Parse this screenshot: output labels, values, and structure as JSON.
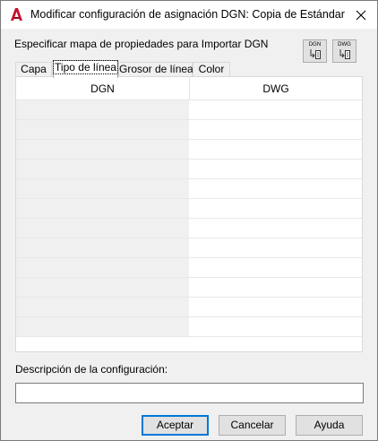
{
  "window": {
    "title": "Modificar configuración de asignación DGN: Copia de Estándar",
    "accent_color": "#0078d7",
    "app_icon": "autocad-logo-icon",
    "close_icon": "close-icon"
  },
  "prompt": "Especificar mapa de propiedades para Importar DGN",
  "icon_buttons": [
    {
      "label": "DGN",
      "icon": "import-from-dgn-icon"
    },
    {
      "label": "DWG",
      "icon": "import-from-dwg-icon"
    }
  ],
  "tabs": [
    {
      "label": "Capa",
      "active": false
    },
    {
      "label": "Tipo de línea",
      "active": true
    },
    {
      "label": "Grosor de línea",
      "active": false
    },
    {
      "label": "Color",
      "active": false
    }
  ],
  "table": {
    "columns": [
      "DGN",
      "DWG"
    ],
    "rows": [
      [
        "",
        ""
      ],
      [
        "",
        ""
      ],
      [
        "",
        ""
      ],
      [
        "",
        ""
      ],
      [
        "",
        ""
      ],
      [
        "",
        ""
      ],
      [
        "",
        ""
      ],
      [
        "",
        ""
      ],
      [
        "",
        ""
      ],
      [
        "",
        ""
      ],
      [
        "",
        ""
      ],
      [
        "",
        ""
      ]
    ]
  },
  "description": {
    "label": "Descripción de la configuración:",
    "value": ""
  },
  "buttons": {
    "ok": "Aceptar",
    "cancel": "Cancelar",
    "help": "Ayuda"
  }
}
